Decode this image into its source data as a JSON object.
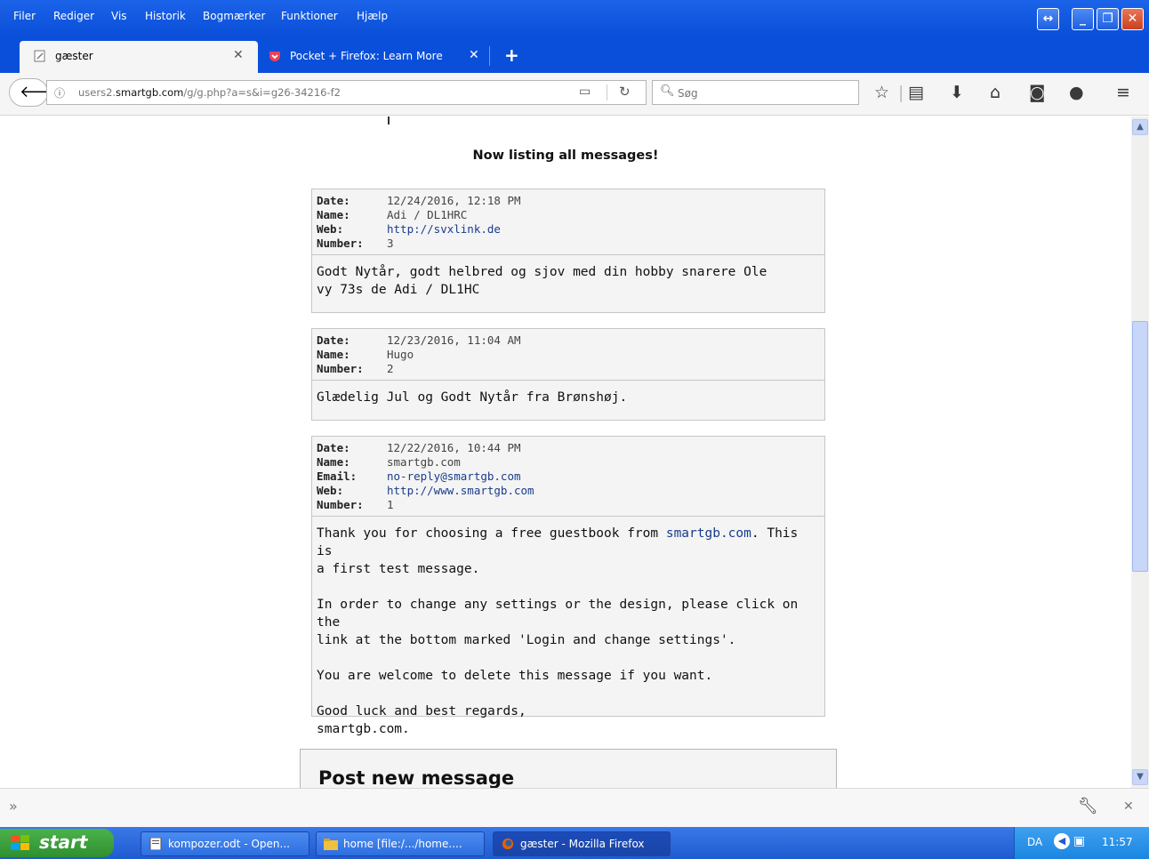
{
  "menu": [
    "Filer",
    "Rediger",
    "Vis",
    "Historik",
    "Bogmærker",
    "Funktioner",
    "Hjælp"
  ],
  "tabs": [
    {
      "label": "gæster",
      "active": true
    },
    {
      "label": "Pocket + Firefox: Learn More",
      "active": false
    }
  ],
  "new_tab": "+",
  "url": {
    "host": "users2.",
    "domain": "smartgb.com",
    "path": "/g/g.php?a=s&i=g26-34216-f2"
  },
  "search": {
    "placeholder": "Søg"
  },
  "page": {
    "heading": "Now listing all messages!",
    "messages": [
      {
        "date_label": "Date:",
        "date": "12/24/2016, 12:18 PM",
        "name_label": "Name:",
        "name": "Adi / DL1HRC",
        "web_label": "Web:",
        "web": "http://svxlink.de",
        "number_label": "Number:",
        "number": "3",
        "body": [
          "Godt Nytår, godt helbred og sjov med din hobby snarere Ole",
          "vy 73s de Adi / DL1HC"
        ]
      },
      {
        "date_label": "Date:",
        "date": "12/23/2016, 11:04 AM",
        "name_label": "Name:",
        "name": "Hugo",
        "number_label": "Number:",
        "number": "2",
        "body": [
          "Glædelig Jul og Godt Nytår fra Brønshøj."
        ]
      },
      {
        "date_label": "Date:",
        "date": "12/22/2016, 10:44 PM",
        "name_label": "Name:",
        "name": "smartgb.com",
        "email_label": "Email:",
        "email": "no-reply@smartgb.com",
        "web_label": "Web:",
        "web": "http://www.smartgb.com",
        "number_label": "Number:",
        "number": "1",
        "p1_pre": "Thank you for choosing a free guestbook from ",
        "p1_link": "smartgb.com",
        "p1_post": ". This is",
        "p1_line2": "a first test message.",
        "p2_line1": "In order to change any settings or the design, please click on the",
        "p2_line2": "link at the bottom marked 'Login and change settings'.",
        "p3": "You are welcome to delete this message if you want.",
        "p4_line1": "Good luck and best regards,",
        "p4_line2": "smartgb.com."
      }
    ],
    "post_title": "Post new message"
  },
  "taskbar": {
    "start": "start",
    "tasks": [
      {
        "label": "kompozer.odt - Open..."
      },
      {
        "label": "home [file:/.../home...."
      },
      {
        "label": "gæster - Mozilla Firefox",
        "active": true
      }
    ],
    "lang": "DA",
    "clock": "11:57"
  }
}
